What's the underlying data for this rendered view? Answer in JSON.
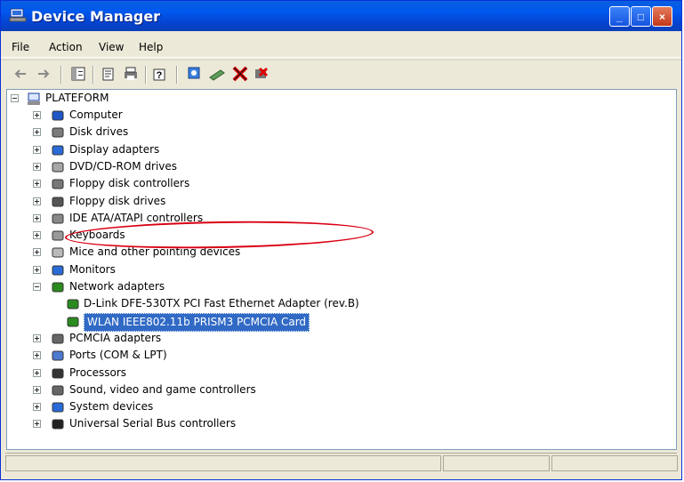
{
  "window": {
    "title": "Device Manager"
  },
  "menu": [
    "File",
    "Action",
    "View",
    "Help"
  ],
  "toolbar": {
    "icons": [
      "back-icon",
      "forward-icon",
      "console-tree-icon",
      "properties-icon",
      "print-icon",
      "help-icon",
      "scan-hardware-icon",
      "update-driver-icon",
      "disable-device-icon",
      "uninstall-icon"
    ]
  },
  "tree": {
    "root": "PLATEFORM",
    "items": [
      "Computer",
      "Disk drives",
      "Display adapters",
      "DVD/CD-ROM drives",
      "Floppy disk controllers",
      "Floppy disk drives",
      "IDE ATA/ATAPI controllers",
      "Keyboards",
      "Mice and other pointing devices",
      "Monitors",
      "Network adapters",
      "D-Link DFE-530TX PCI Fast Ethernet Adapter (rev.B)",
      "WLAN IEEE802.11b PRISM3 PCMCIA Card",
      "PCMCIA adapters",
      "Ports (COM & LPT)",
      "Processors",
      "Sound, video and game controllers",
      "System devices",
      "Universal Serial Bus controllers"
    ]
  },
  "colors": {
    "title": "#0058ee",
    "selection": "#316ac5",
    "annotation": "#d90012"
  }
}
